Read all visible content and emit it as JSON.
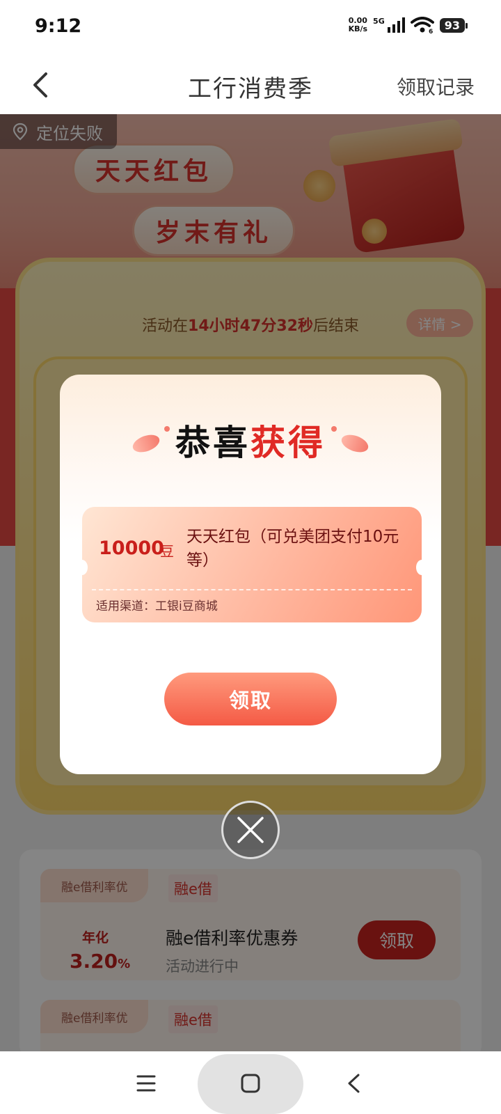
{
  "status": {
    "time": "9:12",
    "net_speed_value": "0.00",
    "net_speed_unit": "KB/s",
    "network": "5G",
    "wifi_badge": "6",
    "battery": "93"
  },
  "header": {
    "title": "工行消费季",
    "right_link": "领取记录"
  },
  "banner": {
    "location": "定位失败",
    "pill1": "天天红包",
    "pill2": "岁末有礼"
  },
  "activity": {
    "countdown_prefix": "活动在",
    "countdown_hours": "14",
    "countdown_h_unit": "小时",
    "countdown_minutes": "47",
    "countdown_m_unit": "分",
    "countdown_seconds": "32",
    "countdown_s_unit": "秒",
    "countdown_suffix": "后结束",
    "details": "详情 >"
  },
  "modal": {
    "title_black": "恭喜",
    "title_red": "获得",
    "prize_amount": "10000",
    "prize_unit": "豆",
    "prize_desc": "天天红包（可兑美团支付10元等）",
    "prize_channel": "适用渠道：工银i豆商城",
    "button": "领取"
  },
  "coupons": [
    {
      "tag": "融e借利率优",
      "chip": "融e借",
      "rate_label": "年化",
      "rate_value": "3.20",
      "rate_unit": "%",
      "name": "融e借利率优惠券",
      "status": "活动进行中",
      "button": "领取"
    },
    {
      "tag": "融e借利率优",
      "chip": "融e借"
    }
  ],
  "colors": {
    "accent_red": "#e02a25",
    "banner_red": "#e84a44",
    "panel_yellow": "#ffd96a"
  }
}
